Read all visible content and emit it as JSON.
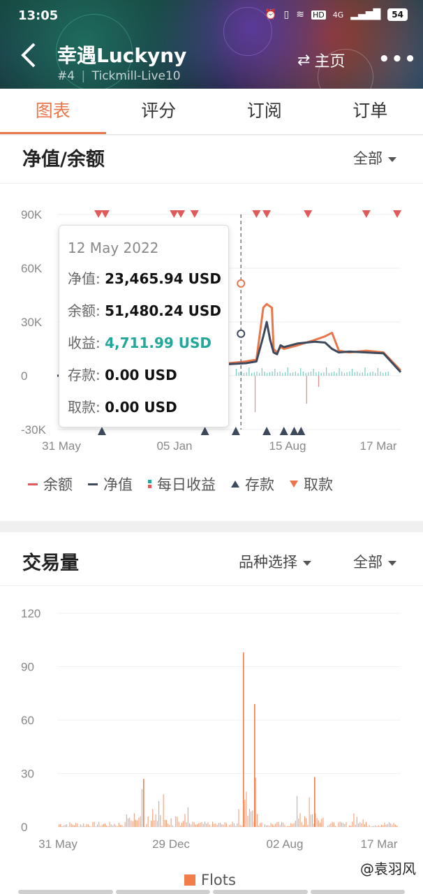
{
  "status_bar": {
    "time": "13:05",
    "network": "4G",
    "hd": "HD",
    "battery": "54"
  },
  "header": {
    "title": "幸遇Luckyny",
    "rank": "#4",
    "account": "Tickmill-Live10",
    "home_label": "主页",
    "more_label": "•••"
  },
  "tabs": [
    {
      "label": "图表",
      "active": true
    },
    {
      "label": "评分",
      "active": false
    },
    {
      "label": "订阅",
      "active": false
    },
    {
      "label": "订单",
      "active": false
    }
  ],
  "equity_card": {
    "title": "净值/余额",
    "filter": "全部",
    "tooltip": {
      "date": "12 May 2022",
      "rows": [
        {
          "key": "净值:",
          "value": "23,465.94 USD"
        },
        {
          "key": "余额:",
          "value": "51,480.24 USD"
        },
        {
          "key": "收益:",
          "value": "4,711.99 USD"
        },
        {
          "key": "存款:",
          "value": "0.00 USD"
        },
        {
          "key": "取款:",
          "value": "0.00 USD"
        }
      ]
    },
    "legend": {
      "balance": "余额",
      "equity": "净值",
      "daily_profit": "每日收益",
      "deposit": "存款",
      "withdrawal": "取款"
    }
  },
  "volume_card": {
    "title": "交易量",
    "symbol_filter": "品种选择",
    "filter": "全部",
    "legend": "Flots"
  },
  "watermark": "@袁羽风",
  "colors": {
    "accent": "#e8764a",
    "equity": "#3d4a5e",
    "balance": "#e8764a",
    "profit_positive": "#22a89a",
    "profit_negative": "#e05a5a",
    "volume": "#f27c4a"
  },
  "chart_data": [
    {
      "type": "line",
      "title": "",
      "y_ticks": [
        "90K",
        "60K",
        "30K",
        "0",
        "-30K"
      ],
      "ylim": [
        -30000,
        90000
      ],
      "x_ticks": [
        "31 May",
        "05 Jan",
        "15 Aug",
        "17 Mar"
      ],
      "series": [
        {
          "name": "余额",
          "x": [
            0.0,
            0.08,
            0.16,
            0.24,
            0.32,
            0.37,
            0.4,
            0.43,
            0.45,
            0.46,
            0.47,
            0.48,
            0.5,
            0.55,
            0.58,
            0.6,
            0.61,
            0.625,
            0.63,
            0.64,
            0.65,
            0.66,
            0.7,
            0.75,
            0.78,
            0.8,
            0.82,
            0.85,
            0.9,
            0.95,
            1.0
          ],
          "y": [
            0,
            1000,
            3000,
            5000,
            12000,
            16000,
            30000,
            51480,
            70000,
            25000,
            7000,
            6000,
            7000,
            8000,
            9000,
            38000,
            40000,
            38000,
            15000,
            13000,
            16000,
            15000,
            17000,
            20000,
            22000,
            24000,
            14000,
            13000,
            14000,
            13000,
            3000
          ]
        },
        {
          "name": "净值",
          "x": [
            0.0,
            0.08,
            0.16,
            0.24,
            0.32,
            0.37,
            0.4,
            0.43,
            0.45,
            0.46,
            0.47,
            0.48,
            0.5,
            0.55,
            0.58,
            0.6,
            0.61,
            0.62,
            0.63,
            0.64,
            0.65,
            0.66,
            0.7,
            0.75,
            0.78,
            0.8,
            0.82,
            0.85,
            0.9,
            0.95,
            1.0
          ],
          "y": [
            0,
            1000,
            3000,
            5000,
            12000,
            14000,
            23466,
            45000,
            62000,
            20000,
            6000,
            5500,
            6500,
            7000,
            8000,
            22000,
            30000,
            20000,
            13000,
            12000,
            17000,
            16000,
            18000,
            19000,
            18500,
            15000,
            13000,
            13500,
            13000,
            12500,
            2000
          ]
        }
      ],
      "deposit_markers_x": [
        "31 May",
        "05 Jan",
        "15 Aug"
      ],
      "withdrawal_markers_count": 12
    },
    {
      "type": "bar",
      "title": "",
      "y_ticks": [
        "120",
        "90",
        "60",
        "30",
        "0"
      ],
      "ylim": [
        0,
        120
      ],
      "x_ticks": [
        "31 May",
        "29 Dec",
        "02 Aug",
        "17 Mar"
      ],
      "series": [
        {
          "name": "Flots",
          "peaks": [
            {
              "at": "29 Dec",
              "value": 27
            },
            {
              "at": "02 Aug",
              "value": 98
            },
            {
              "at": "02 Aug",
              "value": 69
            },
            {
              "at": "17 Mar",
              "value": 28
            }
          ]
        }
      ]
    }
  ]
}
